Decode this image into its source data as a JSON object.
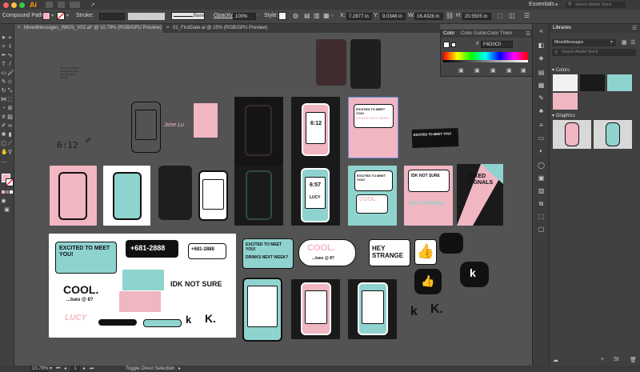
{
  "app": {
    "name": "Ai",
    "workspace": "Essentials",
    "search_placeholder": "Search Adobe Stock"
  },
  "control_bar": {
    "selection_type": "Compound Path",
    "stroke_label": "Stroke:",
    "brush_label": "Basic",
    "opacity_label": "Opacity:",
    "opacity_value": "100%",
    "style_label": "Style:",
    "x_label": "X:",
    "x_value": "7.2877 in",
    "y_label": "Y:",
    "y_value": "9.0348 in",
    "w_label": "W:",
    "w_value": "16.4328 in",
    "h_label": "H:",
    "h_value": "20.5505 in"
  },
  "tabs": [
    {
      "label": "MixedMessages_WK01_V02.ai* @ 10.79% (RGB/GPU Preview)",
      "active": true
    },
    {
      "label": "01_FirstDate.ai @ 25% (RGB/GPU Preview)",
      "active": false
    }
  ],
  "color_panel": {
    "tabs": [
      "Color",
      "Color Guide",
      "Color Them"
    ],
    "hex_value": "F4D0C0"
  },
  "libraries": {
    "title": "Libraries",
    "library_name": "MixedMessages",
    "search_placeholder": "Search Adobe Stock",
    "colors_header": "Colors",
    "graphics_header": "Graphics",
    "swatch_colors": [
      "#f2f2f2",
      "#1a1a1a",
      "#8fd3cf",
      "#f0b6c2"
    ]
  },
  "status_bar": {
    "zoom": "10.79%",
    "page": "1",
    "toggle_label": "Toggle Direct Selection"
  },
  "canvas": {
    "note_lines": [
      "Scroll through this",
      "whole thing again",
      "from the bottom",
      "for next"
    ],
    "time_text": "6:12",
    "sketch_text": "Jone Lu",
    "phone_time_1": "6:12",
    "phone_time_2": "6:57",
    "lettering": {
      "excited": "EXCITED TO MEET YOU!",
      "drinks": "DRINKS NEXT WEEK?",
      "cool": "COOL.",
      "tues": "...tues @ 8?",
      "phone_number": "+681-2888",
      "idk": "IDK NOT SURE",
      "hey": "HEY STRANGE",
      "mixed": "MIXED SIGNALS",
      "lucy": "LUCY",
      "k": "K."
    }
  }
}
